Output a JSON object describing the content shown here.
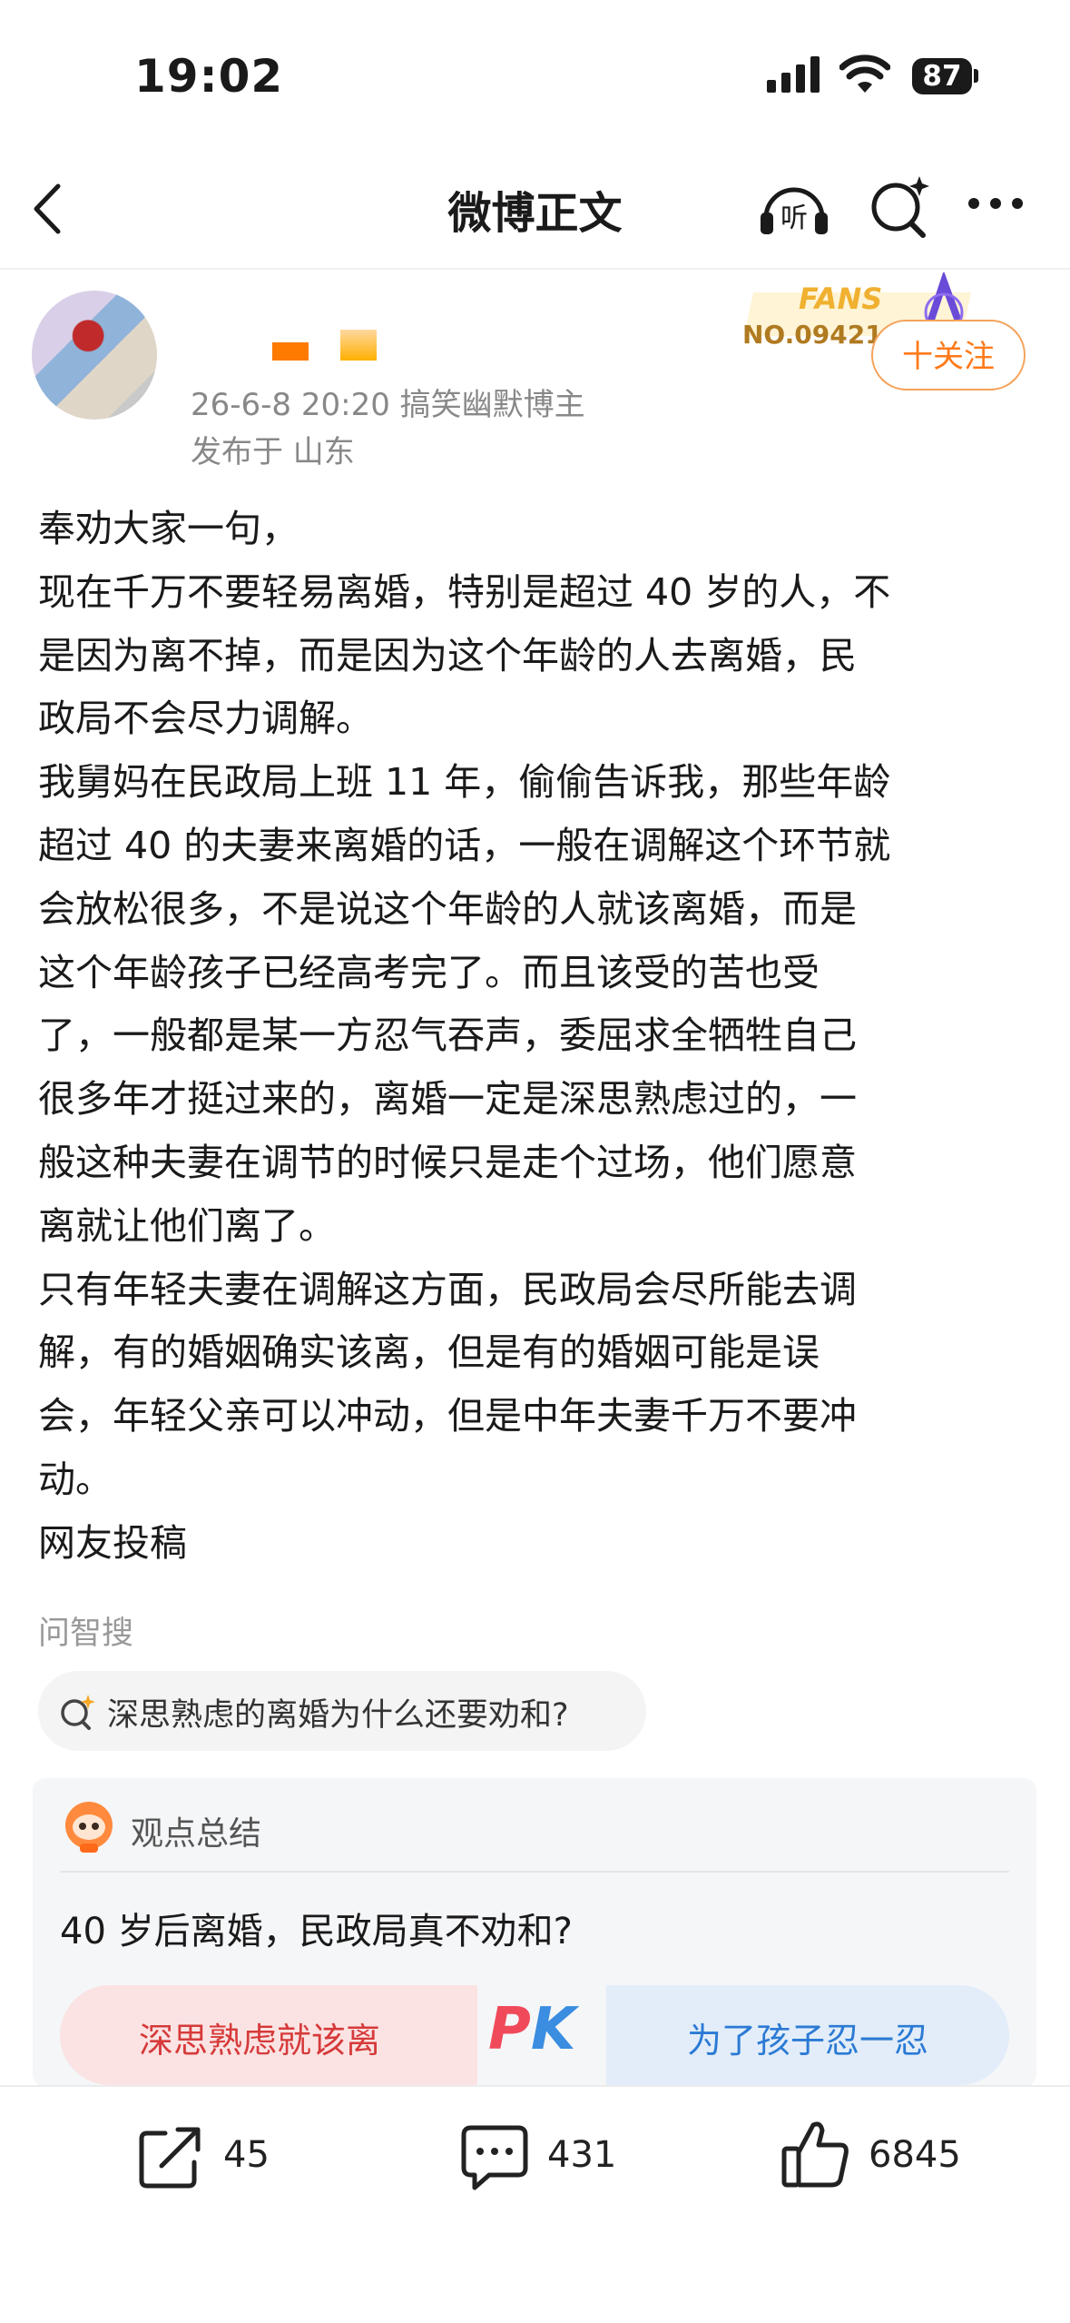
{
  "status_bar": {
    "time": "19:02",
    "battery": "87"
  },
  "nav": {
    "title": "微博正文"
  },
  "author": {
    "meta_line1": "26-6-8 20:20  搞笑幽默博主",
    "meta_line2": "发布于 山东",
    "fans_badge_word": "FANS",
    "fans_badge_no": "NO.094210",
    "follow_label": "十关注"
  },
  "post": {
    "lines": [
      "奉劝大家一句，",
      "现在千万不要轻易离婚，特别是超过 40 岁的人，不",
      "是因为离不掉，而是因为这个年龄的人去离婚，民",
      "政局不会尽力调解。",
      "我舅妈在民政局上班 11 年，偷偷告诉我，那些年龄",
      "超过 40 的夫妻来离婚的话，一般在调解这个环节就",
      "会放松很多，不是说这个年龄的人就该离婚，而是",
      "这个年龄孩子已经高考完了。而且该受的苦也受",
      "了，一般都是某一方忍气吞声，委屈求全牺牲自己",
      "很多年才挺过来的，离婚一定是深思熟虑过的，一",
      "般这种夫妻在调节的时候只是走个过场，他们愿意",
      "离就让他们离了。",
      "只有年轻夫妻在调解这方面，民政局会尽所能去调",
      "解，有的婚姻确实该离，但是有的婚姻可能是误",
      "会，年轻父亲可以冲动，但是中年夫妻千万不要冲",
      "动。",
      "网友投稿"
    ]
  },
  "ask": {
    "label": "问智搜",
    "query": "深思熟虑的离婚为什么还要劝和?"
  },
  "summary": {
    "label": "观点总结",
    "question": "40 岁后离婚，民政局真不劝和?",
    "pk_left": "深思熟虑就该离",
    "pk_p": "P",
    "pk_k": "K",
    "pk_right": "为了孩子忍一忍"
  },
  "actions": {
    "share_count": "45",
    "comment_count": "431",
    "like_count": "6845"
  },
  "colors": {
    "accent_orange": "#ff7a1a",
    "pk_red": "#d63a3a",
    "pk_blue": "#2b7ad4"
  }
}
